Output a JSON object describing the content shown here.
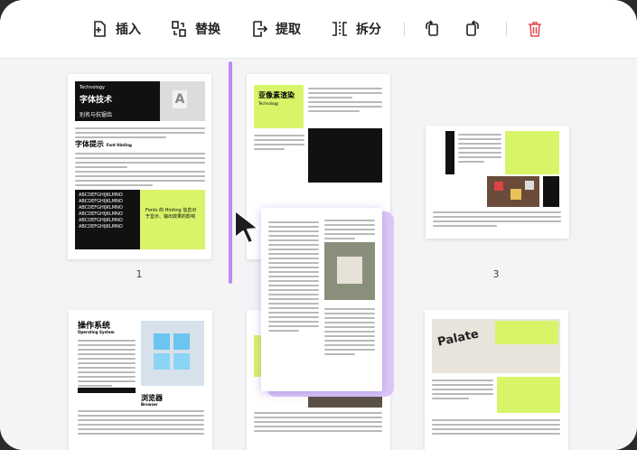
{
  "toolbar": {
    "insert_label": "插入",
    "replace_label": "替换",
    "extract_label": "提取",
    "split_label": "拆分",
    "accent_delete": "#e5484d"
  },
  "pages": {
    "p1": {
      "header": "Technology",
      "title": "字体技术",
      "subtitle": "别名与抗锯齿",
      "section_title": "字体提示",
      "section_sub": "Font Hinting",
      "box_text": "Fonts 的 Hinting 信息对于显示、输出效果的影响",
      "number": "1"
    },
    "p2": {
      "title": "亚像素渲染",
      "sub": "Technology"
    },
    "p3": {
      "number": "3"
    },
    "p4": {
      "title": "操作系统",
      "sub": "Operating System",
      "section_title": "浏览器",
      "section_sub": "Browser"
    }
  },
  "colors": {
    "lime": "#d8f56a",
    "insert_line": "#b98af2"
  }
}
